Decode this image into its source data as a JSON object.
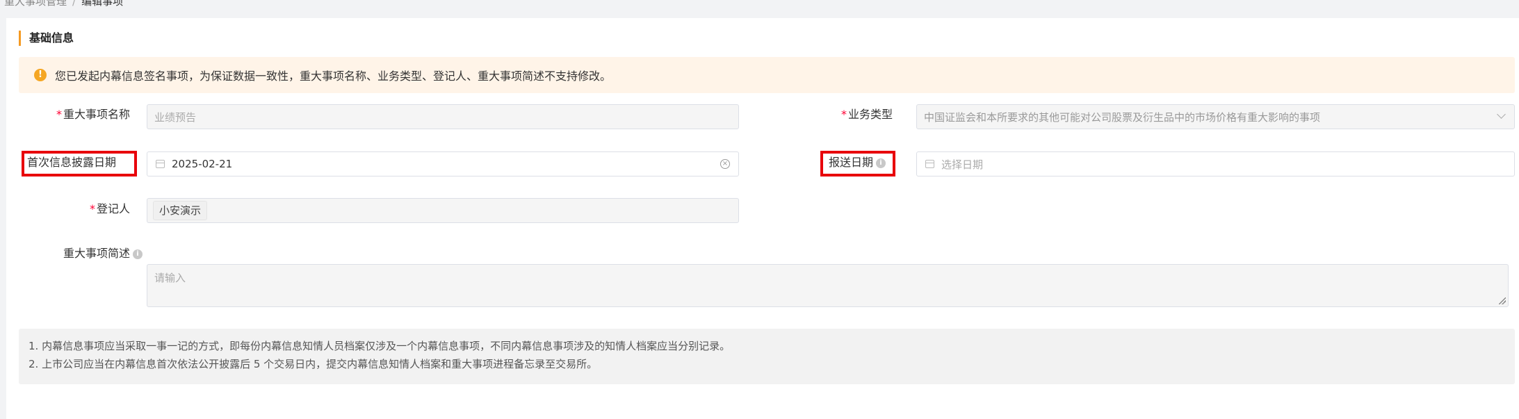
{
  "breadcrumb": {
    "parent": "重大事项管理",
    "separator": "/",
    "current": "编辑事项"
  },
  "section": {
    "title": "基础信息"
  },
  "notice": {
    "icon": "warning-icon",
    "icon_glyph": "!",
    "text": "您已发起内幕信息签名事项，为保证数据一致性，重大事项名称、业务类型、登记人、重大事项简述不支持修改。"
  },
  "form": {
    "required_mark": "*",
    "matter_name": {
      "label": "重大事项名称",
      "placeholder": "业绩预告"
    },
    "business_type": {
      "label": "业务类型",
      "value": "中国证监会和本所要求的其他可能对公司股票及衍生品中的市场价格有重大影响的事项"
    },
    "first_disclosure_date": {
      "label": "首次信息披露日期",
      "value": "2025-02-21"
    },
    "submit_date": {
      "label": "报送日期",
      "placeholder": "选择日期"
    },
    "registrant": {
      "label": "登记人",
      "value": "小安演示"
    },
    "description": {
      "label": "重大事项简述",
      "placeholder": "请输入"
    }
  },
  "notes": [
    "1. 内幕信息事项应当采取一事一记的方式，即每份内幕信息知情人员档案仅涉及一个内幕信息事项，不同内幕信息事项涉及的知情人档案应当分别记录。",
    "2. 上市公司应当在内幕信息首次依法公开披露后 5 个交易日内，提交内幕信息知情人档案和重大事项进程备忘录至交易所。"
  ],
  "colors": {
    "accent": "#f59a23",
    "highlight_box": "#e8000b",
    "notice_bg": "#fff4e8"
  }
}
